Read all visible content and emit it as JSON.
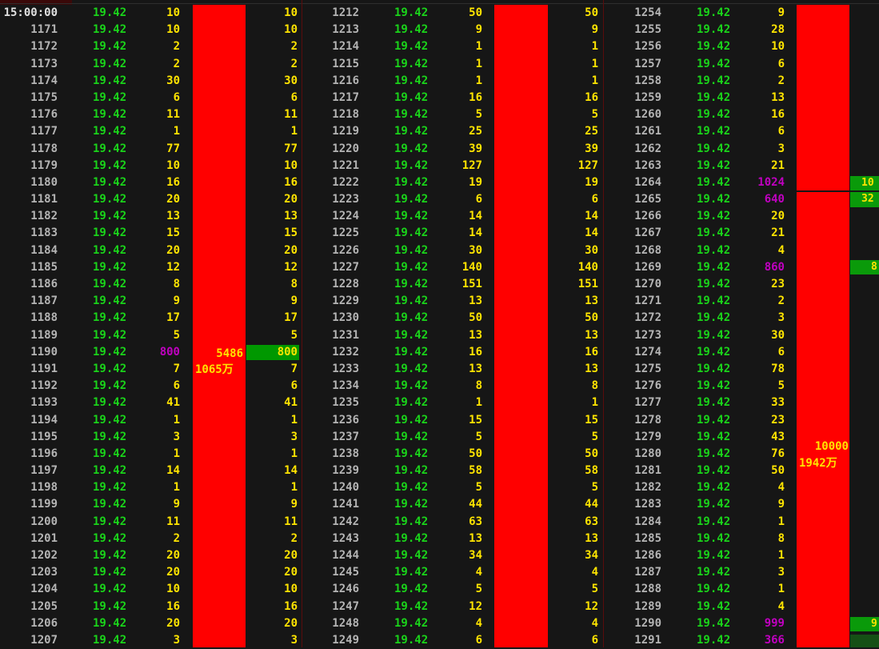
{
  "colors": {
    "background": "#161616",
    "seq": "#b4b4b4",
    "price": "#1ad41a",
    "volume": "#ffe400",
    "large_volume": "#c000c0",
    "bar": "#ff0000",
    "highlight": "#009800"
  },
  "header_time": "15:00:00",
  "columns": [
    {
      "rows": [
        [
          "15:00:00",
          "19.42",
          "10"
        ],
        [
          "1171",
          "19.42",
          "10"
        ],
        [
          "1172",
          "19.42",
          "2"
        ],
        [
          "1173",
          "19.42",
          "2"
        ],
        [
          "1174",
          "19.42",
          "30"
        ],
        [
          "1175",
          "19.42",
          "6"
        ],
        [
          "1176",
          "19.42",
          "11"
        ],
        [
          "1177",
          "19.42",
          "1"
        ],
        [
          "1178",
          "19.42",
          "77"
        ],
        [
          "1179",
          "19.42",
          "10"
        ],
        [
          "1180",
          "19.42",
          "16"
        ],
        [
          "1181",
          "19.42",
          "20"
        ],
        [
          "1182",
          "19.42",
          "13"
        ],
        [
          "1183",
          "19.42",
          "15"
        ],
        [
          "1184",
          "19.42",
          "20"
        ],
        [
          "1185",
          "19.42",
          "12"
        ],
        [
          "1186",
          "19.42",
          "8"
        ],
        [
          "1187",
          "19.42",
          "9"
        ],
        [
          "1188",
          "19.42",
          "17"
        ],
        [
          "1189",
          "19.42",
          "5"
        ],
        [
          "1190",
          "19.42",
          "800"
        ],
        [
          "1191",
          "19.42",
          "7"
        ],
        [
          "1192",
          "19.42",
          "6"
        ],
        [
          "1193",
          "19.42",
          "41"
        ],
        [
          "1194",
          "19.42",
          "1"
        ],
        [
          "1195",
          "19.42",
          "3"
        ],
        [
          "1196",
          "19.42",
          "1"
        ],
        [
          "1197",
          "19.42",
          "14"
        ],
        [
          "1198",
          "19.42",
          "1"
        ],
        [
          "1199",
          "19.42",
          "9"
        ],
        [
          "1200",
          "19.42",
          "11"
        ],
        [
          "1201",
          "19.42",
          "2"
        ],
        [
          "1202",
          "19.42",
          "20"
        ],
        [
          "1203",
          "19.42",
          "20"
        ],
        [
          "1204",
          "19.42",
          "10"
        ],
        [
          "1205",
          "19.42",
          "16"
        ],
        [
          "1206",
          "19.42",
          "20"
        ],
        [
          "1207",
          "19.42",
          "3"
        ]
      ],
      "summary": {
        "shares": "5486",
        "amount": "1065万"
      }
    },
    {
      "rows": [
        [
          "1212",
          "19.42",
          "50"
        ],
        [
          "1213",
          "19.42",
          "9"
        ],
        [
          "1214",
          "19.42",
          "1"
        ],
        [
          "1215",
          "19.42",
          "1"
        ],
        [
          "1216",
          "19.42",
          "1"
        ],
        [
          "1217",
          "19.42",
          "16"
        ],
        [
          "1218",
          "19.42",
          "5"
        ],
        [
          "1219",
          "19.42",
          "25"
        ],
        [
          "1220",
          "19.42",
          "39"
        ],
        [
          "1221",
          "19.42",
          "127"
        ],
        [
          "1222",
          "19.42",
          "19"
        ],
        [
          "1223",
          "19.42",
          "6"
        ],
        [
          "1224",
          "19.42",
          "14"
        ],
        [
          "1225",
          "19.42",
          "14"
        ],
        [
          "1226",
          "19.42",
          "30"
        ],
        [
          "1227",
          "19.42",
          "140"
        ],
        [
          "1228",
          "19.42",
          "151"
        ],
        [
          "1229",
          "19.42",
          "13"
        ],
        [
          "1230",
          "19.42",
          "50"
        ],
        [
          "1231",
          "19.42",
          "13"
        ],
        [
          "1232",
          "19.42",
          "16"
        ],
        [
          "1233",
          "19.42",
          "13"
        ],
        [
          "1234",
          "19.42",
          "8"
        ],
        [
          "1235",
          "19.42",
          "1"
        ],
        [
          "1236",
          "19.42",
          "15"
        ],
        [
          "1237",
          "19.42",
          "5"
        ],
        [
          "1238",
          "19.42",
          "50"
        ],
        [
          "1239",
          "19.42",
          "58"
        ],
        [
          "1240",
          "19.42",
          "5"
        ],
        [
          "1241",
          "19.42",
          "44"
        ],
        [
          "1242",
          "19.42",
          "63"
        ],
        [
          "1243",
          "19.42",
          "13"
        ],
        [
          "1244",
          "19.42",
          "34"
        ],
        [
          "1245",
          "19.42",
          "4"
        ],
        [
          "1246",
          "19.42",
          "5"
        ],
        [
          "1247",
          "19.42",
          "12"
        ],
        [
          "1248",
          "19.42",
          "4"
        ],
        [
          "1249",
          "19.42",
          "6"
        ]
      ]
    },
    {
      "rows": [
        [
          "1254",
          "19.42",
          "9"
        ],
        [
          "1255",
          "19.42",
          "28"
        ],
        [
          "1256",
          "19.42",
          "10"
        ],
        [
          "1257",
          "19.42",
          "6"
        ],
        [
          "1258",
          "19.42",
          "2"
        ],
        [
          "1259",
          "19.42",
          "13"
        ],
        [
          "1260",
          "19.42",
          "16"
        ],
        [
          "1261",
          "19.42",
          "6"
        ],
        [
          "1262",
          "19.42",
          "3"
        ],
        [
          "1263",
          "19.42",
          "21"
        ],
        [
          "1264",
          "19.42",
          "1024"
        ],
        [
          "1265",
          "19.42",
          "640"
        ],
        [
          "1266",
          "19.42",
          "20"
        ],
        [
          "1267",
          "19.42",
          "21"
        ],
        [
          "1268",
          "19.42",
          "4"
        ],
        [
          "1269",
          "19.42",
          "860"
        ],
        [
          "1270",
          "19.42",
          "23"
        ],
        [
          "1271",
          "19.42",
          "2"
        ],
        [
          "1272",
          "19.42",
          "3"
        ],
        [
          "1273",
          "19.42",
          "30"
        ],
        [
          "1274",
          "19.42",
          "6"
        ],
        [
          "1275",
          "19.42",
          "78"
        ],
        [
          "1276",
          "19.42",
          "5"
        ],
        [
          "1277",
          "19.42",
          "33"
        ],
        [
          "1278",
          "19.42",
          "23"
        ],
        [
          "1279",
          "19.42",
          "43"
        ],
        [
          "1280",
          "19.42",
          "76"
        ],
        [
          "1281",
          "19.42",
          "50"
        ],
        [
          "1282",
          "19.42",
          "4"
        ],
        [
          "1283",
          "19.42",
          "9"
        ],
        [
          "1284",
          "19.42",
          "1"
        ],
        [
          "1285",
          "19.42",
          "8"
        ],
        [
          "1286",
          "19.42",
          "1"
        ],
        [
          "1287",
          "19.42",
          "3"
        ],
        [
          "1288",
          "19.42",
          "1"
        ],
        [
          "1289",
          "19.42",
          "4"
        ],
        [
          "1290",
          "19.42",
          "999"
        ],
        [
          "1291",
          "19.42",
          "366"
        ]
      ],
      "summary": {
        "shares": "10000",
        "amount": "1942万"
      }
    }
  ],
  "right_edge": {
    "strip1_line1": "10",
    "strip1_line2": "32",
    "strip2": "8",
    "strip3": "9"
  }
}
